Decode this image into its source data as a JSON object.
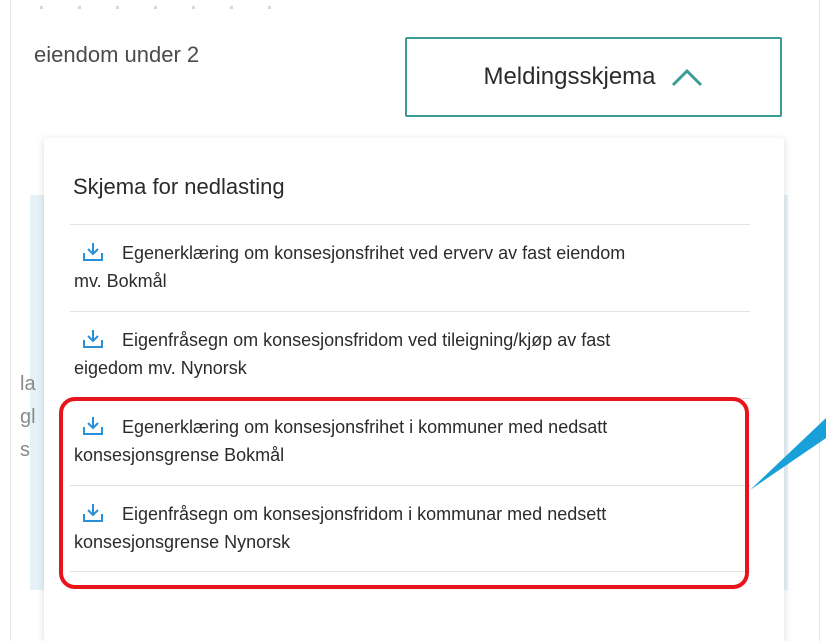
{
  "background_text": {
    "truncated_line": "eiendom under 2",
    "side_fragments": [
      "la",
      "gl",
      "s"
    ]
  },
  "toggle_button": {
    "label": "Meldingsskjema",
    "icon": "chevron-up-icon"
  },
  "dropdown": {
    "title": "Skjema for nedlasting",
    "items": [
      {
        "line1": "Egenerklæring om konsesjonsfrihet ved erverv av fast eiendom",
        "line2": "mv. Bokmål",
        "icon": "download-icon"
      },
      {
        "line1": "Eigenfråsegn om konsesjonsfridom ved tileigning/kjøp av fast",
        "line2": "eigedom mv. Nynorsk",
        "icon": "download-icon"
      },
      {
        "line1": "Egenerklæring om konsesjonsfrihet i kommuner med nedsatt",
        "line2": "konsesjonsgrense Bokmål",
        "icon": "download-icon"
      },
      {
        "line1": "Eigenfråsegn om konsesjonsfridom i kommunar med nedsett",
        "line2": "konsesjonsgrense Nynorsk",
        "icon": "download-icon"
      }
    ]
  },
  "colors": {
    "accent": "#3a9b97",
    "icon_blue": "#2a8fd6",
    "highlight_red": "#e8141c",
    "panel_bg": "#e5f3f8"
  }
}
